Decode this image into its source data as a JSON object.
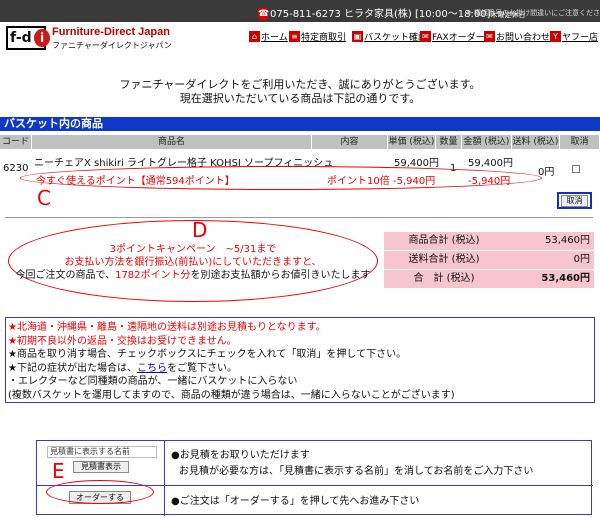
{
  "topbar": {
    "phone": "075-811-6273 ヒラタ家具(株) [10:00～18:00]",
    "hours_note": "木曜定休日",
    "note": "※ 電話番号のお掛け間違いにご注意ください"
  },
  "brand": {
    "logo": "f-d",
    "logo_mark": "i",
    "name_en": "Furniture-Direct Japan",
    "name_jp": "ファニチャーダイレクトジャパン"
  },
  "nav": [
    {
      "label": "ホーム",
      "icon": "home-icon"
    },
    {
      "label": "特定商取引",
      "icon": "document-icon"
    },
    {
      "label": "バスケット確認",
      "icon": "cart-icon"
    },
    {
      "label": "FAXオーダー",
      "icon": "fax-icon"
    },
    {
      "label": "お問い合わせ",
      "icon": "mail-icon"
    },
    {
      "label": "ヤフー店",
      "icon": "yahoo-icon"
    }
  ],
  "greeting": {
    "line1": "ファニチャーダイレクトをご利用いただき、誠にありがとうございます。",
    "line2": "現在選択いただいている商品は下記の通りです。"
  },
  "basket": {
    "title": "バスケット内の商品",
    "headers": [
      "コード",
      "商品名",
      "内容",
      "単価 (税込)",
      "数量",
      "金額 (税込)",
      "送料 (税込)",
      "取消"
    ],
    "item": {
      "code": "6230",
      "name": "ニーチェアX  shikiri  ライトグレー格子 KOHSI ソープフィニッシュ",
      "unit_price": "59,400円",
      "qty": "1",
      "amount": "59,400円",
      "shipping": "0円",
      "points_label": "今すぐ使えるポイント【通常594ポイント】",
      "points_content": "ポイント10倍",
      "points_unit": "-5,940円",
      "points_amount": "-5,940円"
    },
    "cancel_label": "取消"
  },
  "annotations": {
    "c": "C",
    "d": "D",
    "e": "E"
  },
  "campaign": {
    "line1": "3ポイントキャンペーン　~5/31まで",
    "line2": "お支払い方法を銀行振込(前払い)にしていただきますと、",
    "line3_pre": "今回ご注文の商品で、",
    "line3_points": "1782ポイント分",
    "line3_post": "を別途お支払額からお値引きいたします"
  },
  "summary": [
    {
      "label": "商品合計 (税込)",
      "value": "53,460円"
    },
    {
      "label": "送料合計 (税込)",
      "value": "0円"
    },
    {
      "label": "合　計 (税込)",
      "value": "53,460円"
    }
  ],
  "notes": {
    "n1": "★北海道・沖縄県・離島・遠隔地の送料は別途お見積もりとなります。",
    "n2": "★初期不良以外の返品・交換はお受けできません。",
    "n3": "★商品を取り消す場合、チェックボックスにチェックを入れて「取消」を押して下さい。",
    "n4_pre": "★下記の症状が出た場合は、",
    "n4_link": "こちら",
    "n4_post": "をご覧下さい。",
    "n5": "・エレクターなど同種類の商品が、一緒にバスケットに入らない",
    "n6": "(複数バスケットを運用してますので、商品の種類が違う場合は、一緒に入らないことがございます)"
  },
  "order": {
    "name_placeholder": "見積書に表示する名前",
    "estimate_button": "見積書表示",
    "estimate_text1": "●お見積をお取りいただけます",
    "estimate_text2": "お見積が必要な方は、「見積書に表示する名前」を消してお名前をご入力下さい",
    "order_button": "オーダーする",
    "order_text": "●ご注文は「オーダーする」を押して先へお進み下さい"
  }
}
